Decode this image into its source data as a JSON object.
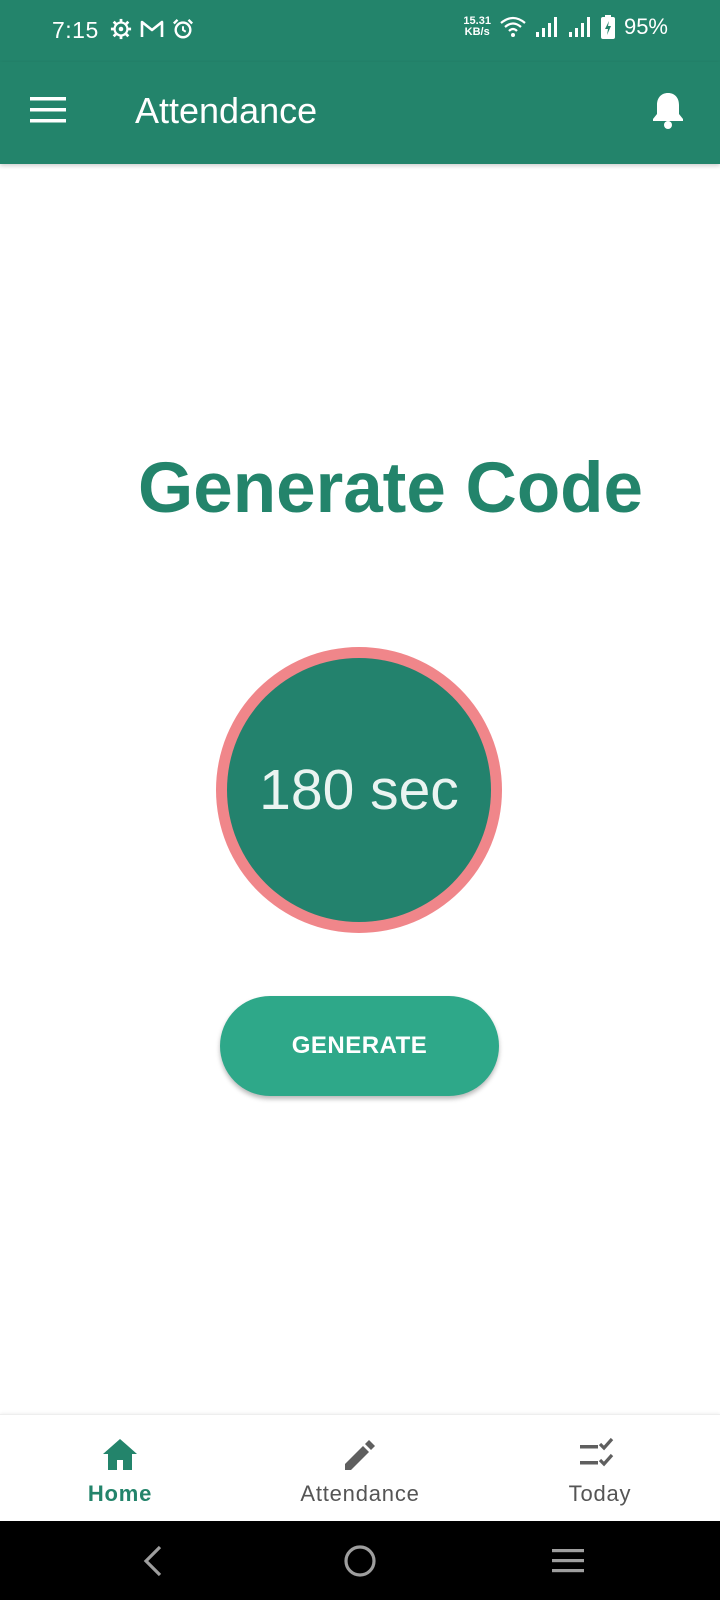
{
  "status_bar": {
    "time": "7:15",
    "net_speed_value": "15.31",
    "net_speed_unit": "KB/s",
    "battery_percent": "95%",
    "left_icons": [
      "settings-gear-icon",
      "gmail-icon",
      "alarm-icon"
    ],
    "right_icons": [
      "wifi-icon",
      "signal-icon",
      "signal-icon",
      "battery-charging-icon"
    ]
  },
  "app_bar": {
    "title": "Attendance",
    "menu_icon": "hamburger-menu-icon",
    "notification_icon": "bell-icon"
  },
  "main": {
    "heading": "Generate Code",
    "timer_text": "180 sec",
    "generate_label": "GENERATE"
  },
  "bottom_nav": {
    "items": [
      {
        "label": "Home",
        "icon": "home-icon",
        "active": true
      },
      {
        "label": "Attendance",
        "icon": "pencil-icon",
        "active": false
      },
      {
        "label": "Today",
        "icon": "checklist-icon",
        "active": false
      }
    ]
  },
  "system_nav": [
    "back-icon",
    "home-circle-icon",
    "recents-menu-icon"
  ],
  "colors": {
    "primary": "#23846b",
    "button": "#2ea889",
    "timer_ring": "#f0868a",
    "timer_fill": "#23826d"
  }
}
